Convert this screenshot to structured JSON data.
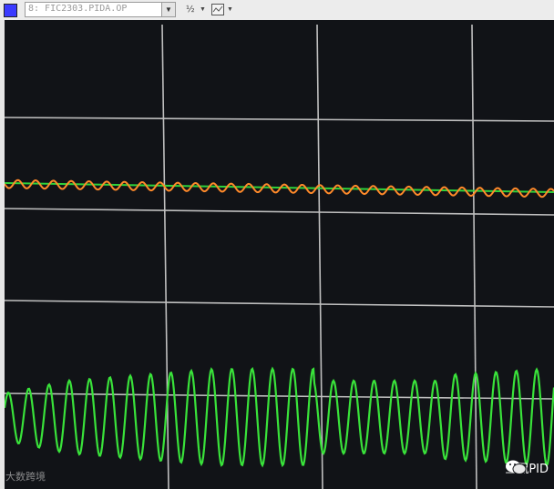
{
  "toolbar": {
    "series_color": "#3a3aff",
    "series_select_value": "8: FIC2303.PIDA.OP",
    "scale_button_icon": "scale-fraction-icon",
    "scale_button_label": "½",
    "zoom_button_icon": "zoom-window-icon"
  },
  "plot": {
    "background": "#111317",
    "grid_color": "#bfbfbf",
    "series": [
      {
        "role": "setpoint",
        "color": "#2fd23a"
      },
      {
        "role": "process-value",
        "color": "#ff8a2a"
      },
      {
        "role": "output",
        "color": "#39e23a"
      }
    ]
  },
  "watermark": {
    "left_text": "大数跨境",
    "right_text": "互侃PID",
    "right_icon": "wechat-icon"
  }
}
